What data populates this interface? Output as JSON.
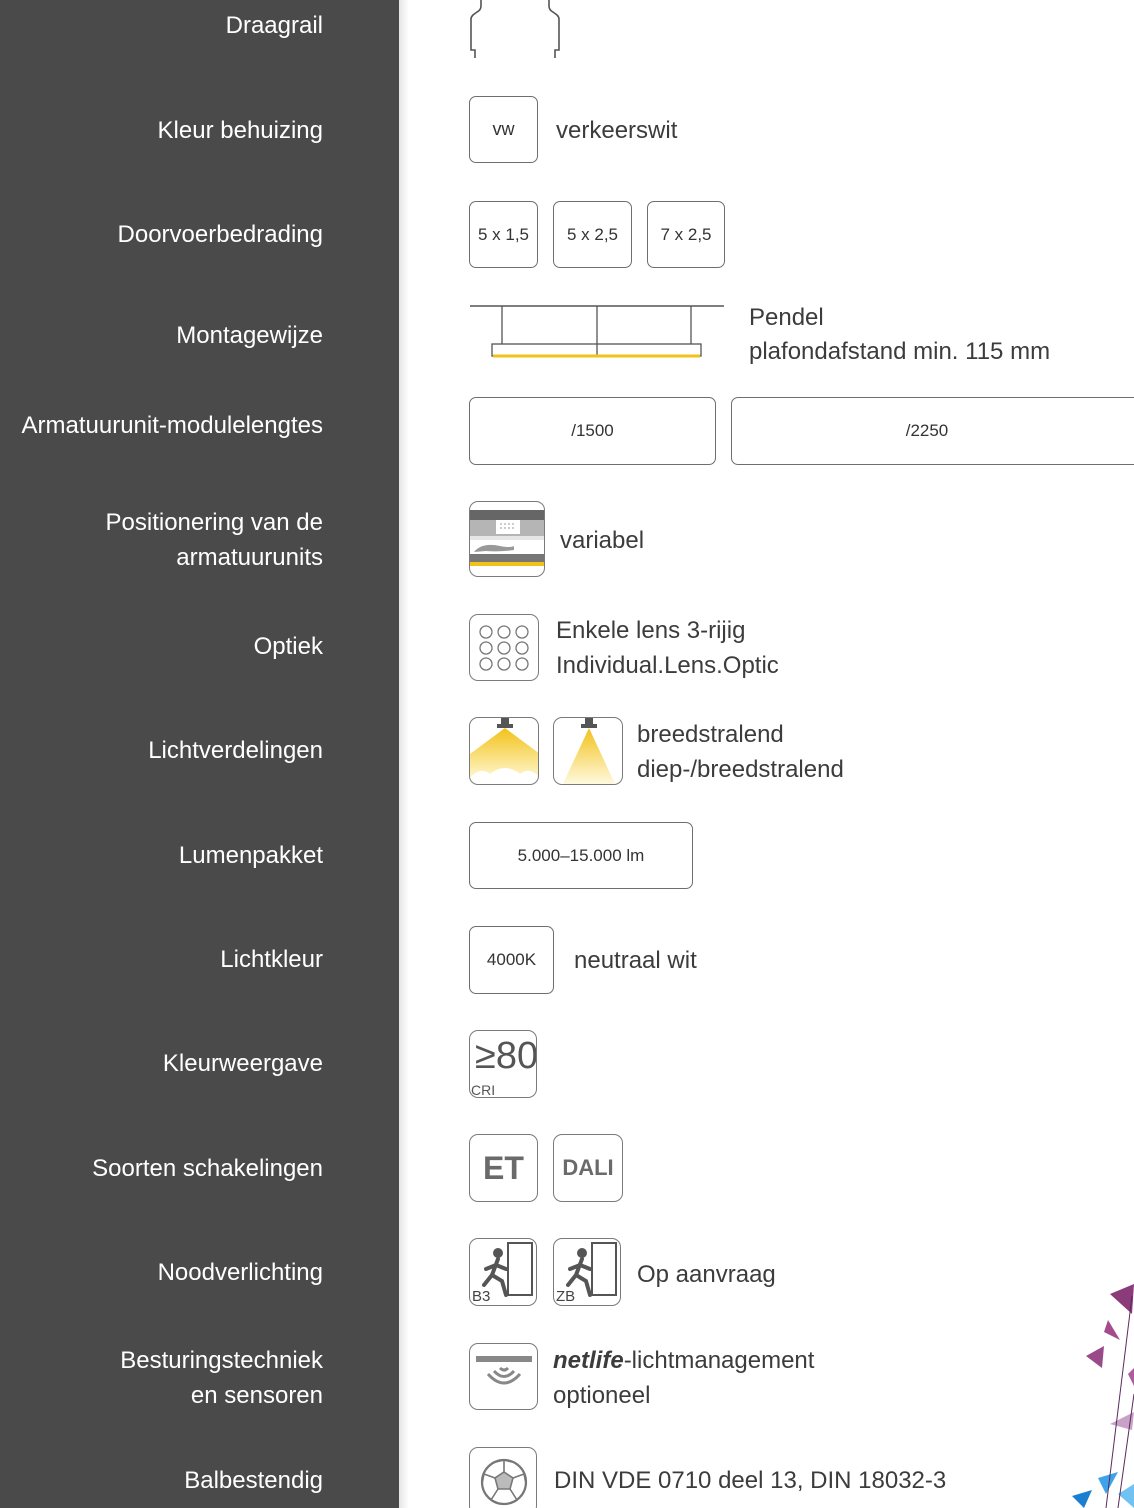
{
  "sidebar": {
    "labels": [
      "Draagrail",
      "Kleur behuizing",
      "Doorvoerbedrading",
      "Montagewijze",
      "Armatuurunit-modulelengtes",
      "Positionering van de",
      "armatuurunits",
      "Optiek",
      "Lichtverdelingen",
      "Lumenpakket",
      "Lichtkleur",
      "Kleurweergave",
      "Soorten schakelingen",
      "Noodverlichting",
      "Besturingstechniek",
      "en sensoren",
      "Balbestendig"
    ]
  },
  "housing_color": {
    "code": "vw",
    "name": "verkeerswit"
  },
  "wiring": {
    "options": [
      "5 x 1,5",
      "5 x 2,5",
      "7 x 2,5"
    ]
  },
  "mounting": {
    "line1": "Pendel",
    "line2": "plafondafstand min. 115 mm"
  },
  "module_lengths": {
    "options": [
      "/1500",
      "/2250"
    ]
  },
  "positioning": {
    "value": "variabel"
  },
  "optic": {
    "line1": "Enkele lens 3-rijig",
    "line2": "Individual.Lens.Optic"
  },
  "distribution": {
    "line1": "breedstralend",
    "line2": "diep-/breedstralend"
  },
  "lumen": {
    "value": "5.000–15.000 lm"
  },
  "light_color": {
    "code": "4000K",
    "name": "neutraal wit"
  },
  "cri": {
    "value": "≥80",
    "label": "CRI"
  },
  "switching": {
    "options": [
      "ET",
      "DALI"
    ]
  },
  "emergency": {
    "labels": [
      "B3",
      "ZB"
    ],
    "text": "Op aanvraag"
  },
  "control": {
    "brand": "netlife",
    "line1_suffix": "-lichtmanagement",
    "line2": "optioneel"
  },
  "ball_proof": {
    "text": "DIN VDE 0710 deel 13, DIN 18032-3"
  },
  "colors": {
    "sidebar": "#4a4a4a",
    "accent_yellow": "#f2c21a",
    "border": "#6e6e6e"
  }
}
